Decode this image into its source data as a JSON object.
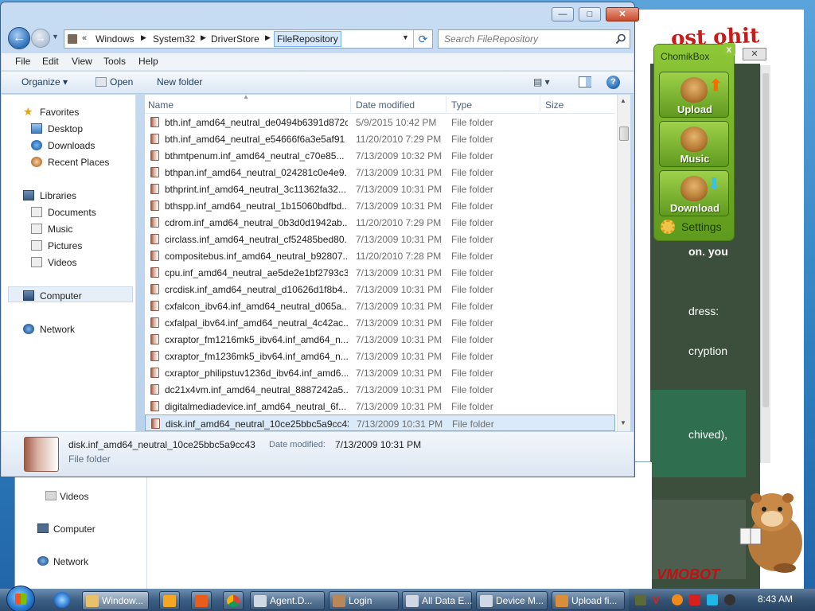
{
  "explorer": {
    "breadcrumbs": [
      "Windows",
      "System32",
      "DriverStore",
      "FileRepository"
    ],
    "breadcrumb_prefix": "«",
    "search_placeholder": "Search FileRepository",
    "menu": {
      "file": "File",
      "edit": "Edit",
      "view": "View",
      "tools": "Tools",
      "help": "Help"
    },
    "toolbar": {
      "organize": "Organize ▾",
      "open": "Open",
      "new_folder": "New folder",
      "views": "▤ ▾",
      "help": "?"
    },
    "window_controls": {
      "minimize": "—",
      "maximize": "□",
      "close": "✕"
    },
    "nav": {
      "favorites": "Favorites",
      "desktop": "Desktop",
      "downloads": "Downloads",
      "recent_places": "Recent Places",
      "libraries": "Libraries",
      "documents": "Documents",
      "music": "Music",
      "pictures": "Pictures",
      "videos": "Videos",
      "computer": "Computer",
      "network": "Network"
    },
    "columns": {
      "name": "Name",
      "date": "Date modified",
      "type": "Type",
      "size": "Size"
    },
    "files": [
      {
        "name": "bth.inf_amd64_neutral_de0494b6391d872c",
        "date": "5/9/2015 10:42 PM",
        "type": "File folder"
      },
      {
        "name": "bth.inf_amd64_neutral_e54666f6a3e5af91",
        "date": "11/20/2010 7:29 PM",
        "type": "File folder"
      },
      {
        "name": "bthmtpenum.inf_amd64_neutral_c70e85...",
        "date": "7/13/2009 10:32 PM",
        "type": "File folder"
      },
      {
        "name": "bthpan.inf_amd64_neutral_024281c0e4e9...",
        "date": "7/13/2009 10:31 PM",
        "type": "File folder"
      },
      {
        "name": "bthprint.inf_amd64_neutral_3c11362fa32...",
        "date": "7/13/2009 10:31 PM",
        "type": "File folder"
      },
      {
        "name": "bthspp.inf_amd64_neutral_1b15060bdfbd...",
        "date": "7/13/2009 10:31 PM",
        "type": "File folder"
      },
      {
        "name": "cdrom.inf_amd64_neutral_0b3d0d1942ab...",
        "date": "11/20/2010 7:29 PM",
        "type": "File folder"
      },
      {
        "name": "circlass.inf_amd64_neutral_cf52485bed80...",
        "date": "7/13/2009 10:31 PM",
        "type": "File folder"
      },
      {
        "name": "compositebus.inf_amd64_neutral_b92807...",
        "date": "11/20/2010 7:28 PM",
        "type": "File folder"
      },
      {
        "name": "cpu.inf_amd64_neutral_ae5de2e1bf2793c3",
        "date": "7/13/2009 10:31 PM",
        "type": "File folder"
      },
      {
        "name": "crcdisk.inf_amd64_neutral_d10626d1f8b4...",
        "date": "7/13/2009 10:31 PM",
        "type": "File folder"
      },
      {
        "name": "cxfalcon_ibv64.inf_amd64_neutral_d065a...",
        "date": "7/13/2009 10:31 PM",
        "type": "File folder"
      },
      {
        "name": "cxfalpal_ibv64.inf_amd64_neutral_4c42ac...",
        "date": "7/13/2009 10:31 PM",
        "type": "File folder"
      },
      {
        "name": "cxraptor_fm1216mk5_ibv64.inf_amd64_n...",
        "date": "7/13/2009 10:31 PM",
        "type": "File folder"
      },
      {
        "name": "cxraptor_fm1236mk5_ibv64.inf_amd64_n...",
        "date": "7/13/2009 10:31 PM",
        "type": "File folder"
      },
      {
        "name": "cxraptor_philipstuv1236d_ibv64.inf_amd6...",
        "date": "7/13/2009 10:31 PM",
        "type": "File folder"
      },
      {
        "name": "dc21x4vm.inf_amd64_neutral_8887242a5...",
        "date": "7/13/2009 10:31 PM",
        "type": "File folder"
      },
      {
        "name": "digitalmediadevice.inf_amd64_neutral_6f...",
        "date": "7/13/2009 10:31 PM",
        "type": "File folder"
      },
      {
        "name": "disk.inf_amd64_neutral_10ce25bbc5a9cc43",
        "date": "7/13/2009 10:31 PM",
        "type": "File folder",
        "selected": true
      }
    ],
    "details": {
      "name": "disk.inf_amd64_neutral_10ce25bbc5a9cc43",
      "modified_label": "Date modified:",
      "modified": "7/13/2009 10:31 PM",
      "type": "File folder"
    }
  },
  "background": {
    "web_text_1": "on. you",
    "web_text_2": "dress:",
    "web_text_3": "cryption",
    "web_text_4": "chived),",
    "web_brand": "VMOBOT",
    "explorer_videos": "Videos",
    "explorer_computer": "Computer",
    "explorer_network": "Network",
    "close": "✕"
  },
  "chomikbox": {
    "title": "ChomikBox",
    "close": "x",
    "upload": "Upload",
    "music": "Music",
    "download": "Download",
    "settings": "Settings"
  },
  "taskbar": {
    "tasks": {
      "explorer": "Window...",
      "agent": "Agent.D...",
      "login": "Login",
      "alldata": "All Data E...",
      "device": "Device M...",
      "upload": "Upload fi..."
    },
    "clock": "8:43 AM"
  },
  "colors": {
    "accent": "#3a5f88",
    "chomik_green": "#8ec737",
    "selection": "#dbeaf9"
  }
}
